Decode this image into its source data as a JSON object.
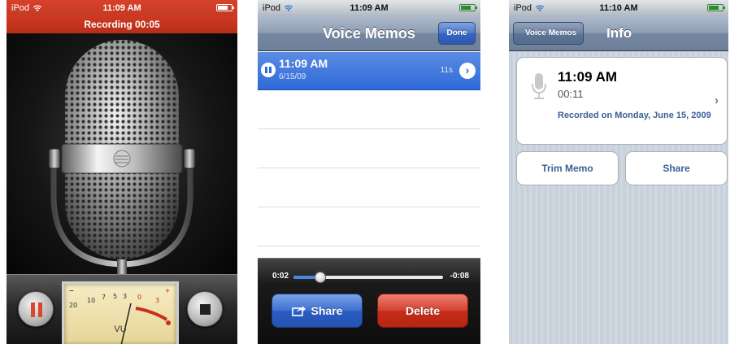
{
  "status": {
    "carrier": "iPod",
    "time_1": "11:09 AM",
    "time_2": "11:09 AM",
    "time_3": "11:10 AM"
  },
  "recorder": {
    "banner": "Recording 00:05",
    "vu_scale_black": [
      "20",
      "10",
      "7",
      "5",
      "3"
    ],
    "vu_scale_red": [
      "0",
      "3"
    ],
    "vu_minus": "−",
    "vu_plus": "+",
    "vu_label": "VU",
    "colors": {
      "record_red": "#c53b24",
      "needle_red": "#d9482e"
    }
  },
  "list_screen": {
    "title": "Voice Memos",
    "done_label": "Done",
    "memos": [
      {
        "time": "11:09 AM",
        "date": "6/15/09",
        "duration": "11s",
        "selected": true
      }
    ],
    "player": {
      "elapsed": "0:02",
      "remaining": "-0:08",
      "progress_fraction": 0.18
    },
    "share_label": "Share",
    "delete_label": "Delete",
    "colors": {
      "share_blue": "#3d6fd1",
      "delete_red": "#d3412e"
    }
  },
  "info_screen": {
    "back_label": "Voice Memos",
    "title": "Info",
    "memo_time": "11:09 AM",
    "memo_duration": "00:11",
    "recorded_on": "Recorded on Monday, June 15, 2009",
    "trim_label": "Trim Memo",
    "share_label": "Share",
    "icons": {
      "mic": "microphone-icon",
      "chevron": "chevron-right-icon"
    }
  }
}
